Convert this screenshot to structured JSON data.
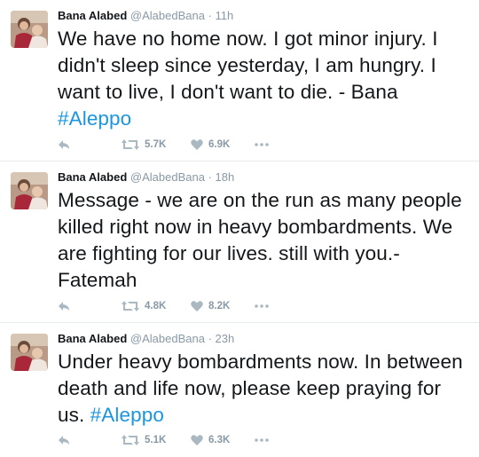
{
  "tweets": [
    {
      "name": "Bana Alabed",
      "handle": "@AlabedBana",
      "separator": "·",
      "time": "11h",
      "text": "We have no home now. I got minor injury. I didn't sleep since yesterday, I am hungry. I want to live, I don't want to die. - Bana ",
      "hashtag": "#Aleppo",
      "retweets": "5.7K",
      "likes": "6.9K"
    },
    {
      "name": "Bana Alabed",
      "handle": "@AlabedBana",
      "separator": "·",
      "time": "18h",
      "text": "Message - we are on the run as many people killed right now in heavy bombardments. We are fighting for our lives. still with you.- Fatemah",
      "hashtag": "",
      "retweets": "4.8K",
      "likes": "8.2K"
    },
    {
      "name": "Bana Alabed",
      "handle": "@AlabedBana",
      "separator": "·",
      "time": "23h",
      "text": "Under heavy bombardments now. In between death and life now, please keep praying for us. ",
      "hashtag": "#Aleppo",
      "retweets": "5.1K",
      "likes": "6.3K"
    }
  ],
  "icons": {
    "reply": "reply-icon",
    "retweet": "retweet-icon",
    "like": "heart-icon",
    "more": "more-icon"
  },
  "colors": {
    "hashtag": "#1b95e0",
    "meta": "#8899a6",
    "text": "#14171a",
    "divider": "#e6ecf0"
  }
}
